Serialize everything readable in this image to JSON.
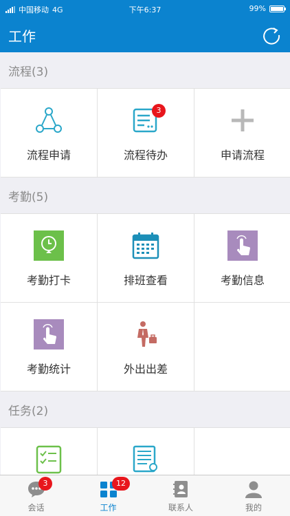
{
  "status_bar": {
    "carrier": "中国移动",
    "network": "4G",
    "time": "下午6:37",
    "battery": "99%",
    "battery_level": 0.99
  },
  "header": {
    "title": "工作",
    "refresh_icon": "refresh-icon"
  },
  "sections": [
    {
      "title": "流程(3)",
      "items": [
        {
          "label": "流程申请",
          "icon": "workflow-nodes-icon",
          "badge": ""
        },
        {
          "label": "流程待办",
          "icon": "todo-list-icon",
          "badge": "3"
        },
        {
          "label": "申请流程",
          "icon": "plus-icon",
          "badge": ""
        }
      ]
    },
    {
      "title": "考勤(5)",
      "items": [
        {
          "label": "考勤打卡",
          "icon": "clock-in-icon",
          "badge": ""
        },
        {
          "label": "排班查看",
          "icon": "calendar-icon",
          "badge": ""
        },
        {
          "label": "考勤信息",
          "icon": "tap-hand-icon",
          "badge": ""
        },
        {
          "label": "考勤统计",
          "icon": "tap-hand-icon",
          "badge": ""
        },
        {
          "label": "外出出差",
          "icon": "business-trip-icon",
          "badge": ""
        }
      ]
    },
    {
      "title": "任务(2)",
      "items": [
        {
          "label": "",
          "icon": "checklist-icon",
          "badge": ""
        },
        {
          "label": "",
          "icon": "task-edit-icon",
          "badge": ""
        }
      ]
    }
  ],
  "tab_bar": [
    {
      "label": "会话",
      "icon": "chat-bubble-icon",
      "badge": "3",
      "active": false
    },
    {
      "label": "工作",
      "icon": "grid-icon",
      "badge": "12",
      "active": true
    },
    {
      "label": "联系人",
      "icon": "contacts-book-icon",
      "badge": "",
      "active": false
    },
    {
      "label": "我的",
      "icon": "person-icon",
      "badge": "",
      "active": false
    }
  ],
  "colors": {
    "brand": "#0b83cf",
    "badge": "#e8161c",
    "green": "#6cc04a",
    "purple": "#a88bbd",
    "teal": "#2aa7c9"
  }
}
